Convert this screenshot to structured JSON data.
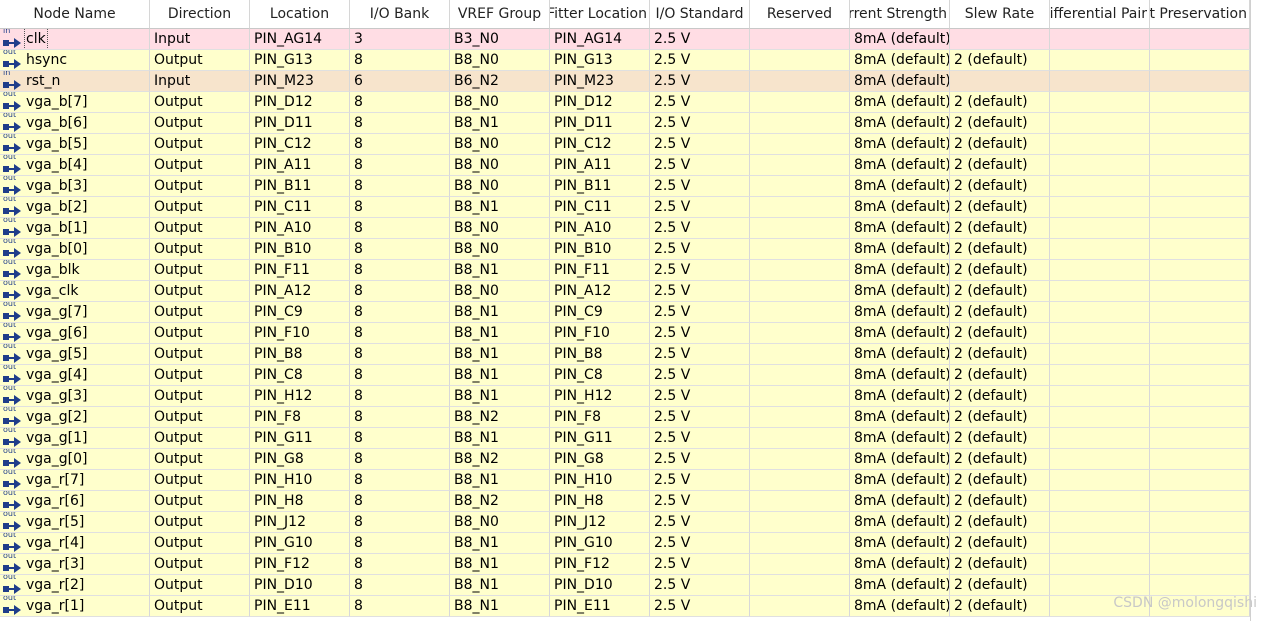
{
  "columns": [
    "Node Name",
    "Direction",
    "Location",
    "I/O Bank",
    "VREF Group",
    "Fitter Location",
    "I/O Standard",
    "Reserved",
    "Current Strength",
    "Slew Rate",
    "Differential Pair",
    "Strict Preservation"
  ],
  "rows": [
    {
      "name": "clk",
      "dir": "Input",
      "loc": "PIN_AG14",
      "bank": "3",
      "vref": "B3_N0",
      "fitter": "PIN_AG14",
      "std": "2.5 V",
      "reserved": "",
      "current": "8mA (default)",
      "slew": "",
      "diff": "",
      "strict": "",
      "icon": "in",
      "state": "sel"
    },
    {
      "name": "hsync",
      "dir": "Output",
      "loc": "PIN_G13",
      "bank": "8",
      "vref": "B8_N0",
      "fitter": "PIN_G13",
      "std": "2.5 V",
      "reserved": "",
      "current": "8mA (default)",
      "slew": "2 (default)",
      "diff": "",
      "strict": "",
      "icon": "out",
      "state": ""
    },
    {
      "name": "rst_n",
      "dir": "Input",
      "loc": "PIN_M23",
      "bank": "6",
      "vref": "B6_N2",
      "fitter": "PIN_M23",
      "std": "2.5 V",
      "reserved": "",
      "current": "8mA (default)",
      "slew": "",
      "diff": "",
      "strict": "",
      "icon": "in",
      "state": "hl"
    },
    {
      "name": "vga_b[7]",
      "dir": "Output",
      "loc": "PIN_D12",
      "bank": "8",
      "vref": "B8_N0",
      "fitter": "PIN_D12",
      "std": "2.5 V",
      "reserved": "",
      "current": "8mA (default)",
      "slew": "2 (default)",
      "diff": "",
      "strict": "",
      "icon": "out",
      "state": ""
    },
    {
      "name": "vga_b[6]",
      "dir": "Output",
      "loc": "PIN_D11",
      "bank": "8",
      "vref": "B8_N1",
      "fitter": "PIN_D11",
      "std": "2.5 V",
      "reserved": "",
      "current": "8mA (default)",
      "slew": "2 (default)",
      "diff": "",
      "strict": "",
      "icon": "out",
      "state": ""
    },
    {
      "name": "vga_b[5]",
      "dir": "Output",
      "loc": "PIN_C12",
      "bank": "8",
      "vref": "B8_N0",
      "fitter": "PIN_C12",
      "std": "2.5 V",
      "reserved": "",
      "current": "8mA (default)",
      "slew": "2 (default)",
      "diff": "",
      "strict": "",
      "icon": "out",
      "state": ""
    },
    {
      "name": "vga_b[4]",
      "dir": "Output",
      "loc": "PIN_A11",
      "bank": "8",
      "vref": "B8_N0",
      "fitter": "PIN_A11",
      "std": "2.5 V",
      "reserved": "",
      "current": "8mA (default)",
      "slew": "2 (default)",
      "diff": "",
      "strict": "",
      "icon": "out",
      "state": ""
    },
    {
      "name": "vga_b[3]",
      "dir": "Output",
      "loc": "PIN_B11",
      "bank": "8",
      "vref": "B8_N0",
      "fitter": "PIN_B11",
      "std": "2.5 V",
      "reserved": "",
      "current": "8mA (default)",
      "slew": "2 (default)",
      "diff": "",
      "strict": "",
      "icon": "out",
      "state": ""
    },
    {
      "name": "vga_b[2]",
      "dir": "Output",
      "loc": "PIN_C11",
      "bank": "8",
      "vref": "B8_N1",
      "fitter": "PIN_C11",
      "std": "2.5 V",
      "reserved": "",
      "current": "8mA (default)",
      "slew": "2 (default)",
      "diff": "",
      "strict": "",
      "icon": "out",
      "state": ""
    },
    {
      "name": "vga_b[1]",
      "dir": "Output",
      "loc": "PIN_A10",
      "bank": "8",
      "vref": "B8_N0",
      "fitter": "PIN_A10",
      "std": "2.5 V",
      "reserved": "",
      "current": "8mA (default)",
      "slew": "2 (default)",
      "diff": "",
      "strict": "",
      "icon": "out",
      "state": ""
    },
    {
      "name": "vga_b[0]",
      "dir": "Output",
      "loc": "PIN_B10",
      "bank": "8",
      "vref": "B8_N0",
      "fitter": "PIN_B10",
      "std": "2.5 V",
      "reserved": "",
      "current": "8mA (default)",
      "slew": "2 (default)",
      "diff": "",
      "strict": "",
      "icon": "out",
      "state": ""
    },
    {
      "name": "vga_blk",
      "dir": "Output",
      "loc": "PIN_F11",
      "bank": "8",
      "vref": "B8_N1",
      "fitter": "PIN_F11",
      "std": "2.5 V",
      "reserved": "",
      "current": "8mA (default)",
      "slew": "2 (default)",
      "diff": "",
      "strict": "",
      "icon": "out",
      "state": ""
    },
    {
      "name": "vga_clk",
      "dir": "Output",
      "loc": "PIN_A12",
      "bank": "8",
      "vref": "B8_N0",
      "fitter": "PIN_A12",
      "std": "2.5 V",
      "reserved": "",
      "current": "8mA (default)",
      "slew": "2 (default)",
      "diff": "",
      "strict": "",
      "icon": "out",
      "state": ""
    },
    {
      "name": "vga_g[7]",
      "dir": "Output",
      "loc": "PIN_C9",
      "bank": "8",
      "vref": "B8_N1",
      "fitter": "PIN_C9",
      "std": "2.5 V",
      "reserved": "",
      "current": "8mA (default)",
      "slew": "2 (default)",
      "diff": "",
      "strict": "",
      "icon": "out",
      "state": ""
    },
    {
      "name": "vga_g[6]",
      "dir": "Output",
      "loc": "PIN_F10",
      "bank": "8",
      "vref": "B8_N1",
      "fitter": "PIN_F10",
      "std": "2.5 V",
      "reserved": "",
      "current": "8mA (default)",
      "slew": "2 (default)",
      "diff": "",
      "strict": "",
      "icon": "out",
      "state": ""
    },
    {
      "name": "vga_g[5]",
      "dir": "Output",
      "loc": "PIN_B8",
      "bank": "8",
      "vref": "B8_N1",
      "fitter": "PIN_B8",
      "std": "2.5 V",
      "reserved": "",
      "current": "8mA (default)",
      "slew": "2 (default)",
      "diff": "",
      "strict": "",
      "icon": "out",
      "state": ""
    },
    {
      "name": "vga_g[4]",
      "dir": "Output",
      "loc": "PIN_C8",
      "bank": "8",
      "vref": "B8_N1",
      "fitter": "PIN_C8",
      "std": "2.5 V",
      "reserved": "",
      "current": "8mA (default)",
      "slew": "2 (default)",
      "diff": "",
      "strict": "",
      "icon": "out",
      "state": ""
    },
    {
      "name": "vga_g[3]",
      "dir": "Output",
      "loc": "PIN_H12",
      "bank": "8",
      "vref": "B8_N1",
      "fitter": "PIN_H12",
      "std": "2.5 V",
      "reserved": "",
      "current": "8mA (default)",
      "slew": "2 (default)",
      "diff": "",
      "strict": "",
      "icon": "out",
      "state": ""
    },
    {
      "name": "vga_g[2]",
      "dir": "Output",
      "loc": "PIN_F8",
      "bank": "8",
      "vref": "B8_N2",
      "fitter": "PIN_F8",
      "std": "2.5 V",
      "reserved": "",
      "current": "8mA (default)",
      "slew": "2 (default)",
      "diff": "",
      "strict": "",
      "icon": "out",
      "state": ""
    },
    {
      "name": "vga_g[1]",
      "dir": "Output",
      "loc": "PIN_G11",
      "bank": "8",
      "vref": "B8_N1",
      "fitter": "PIN_G11",
      "std": "2.5 V",
      "reserved": "",
      "current": "8mA (default)",
      "slew": "2 (default)",
      "diff": "",
      "strict": "",
      "icon": "out",
      "state": ""
    },
    {
      "name": "vga_g[0]",
      "dir": "Output",
      "loc": "PIN_G8",
      "bank": "8",
      "vref": "B8_N2",
      "fitter": "PIN_G8",
      "std": "2.5 V",
      "reserved": "",
      "current": "8mA (default)",
      "slew": "2 (default)",
      "diff": "",
      "strict": "",
      "icon": "out",
      "state": ""
    },
    {
      "name": "vga_r[7]",
      "dir": "Output",
      "loc": "PIN_H10",
      "bank": "8",
      "vref": "B8_N1",
      "fitter": "PIN_H10",
      "std": "2.5 V",
      "reserved": "",
      "current": "8mA (default)",
      "slew": "2 (default)",
      "diff": "",
      "strict": "",
      "icon": "out",
      "state": ""
    },
    {
      "name": "vga_r[6]",
      "dir": "Output",
      "loc": "PIN_H8",
      "bank": "8",
      "vref": "B8_N2",
      "fitter": "PIN_H8",
      "std": "2.5 V",
      "reserved": "",
      "current": "8mA (default)",
      "slew": "2 (default)",
      "diff": "",
      "strict": "",
      "icon": "out",
      "state": ""
    },
    {
      "name": "vga_r[5]",
      "dir": "Output",
      "loc": "PIN_J12",
      "bank": "8",
      "vref": "B8_N0",
      "fitter": "PIN_J12",
      "std": "2.5 V",
      "reserved": "",
      "current": "8mA (default)",
      "slew": "2 (default)",
      "diff": "",
      "strict": "",
      "icon": "out",
      "state": ""
    },
    {
      "name": "vga_r[4]",
      "dir": "Output",
      "loc": "PIN_G10",
      "bank": "8",
      "vref": "B8_N1",
      "fitter": "PIN_G10",
      "std": "2.5 V",
      "reserved": "",
      "current": "8mA (default)",
      "slew": "2 (default)",
      "diff": "",
      "strict": "",
      "icon": "out",
      "state": ""
    },
    {
      "name": "vga_r[3]",
      "dir": "Output",
      "loc": "PIN_F12",
      "bank": "8",
      "vref": "B8_N1",
      "fitter": "PIN_F12",
      "std": "2.5 V",
      "reserved": "",
      "current": "8mA (default)",
      "slew": "2 (default)",
      "diff": "",
      "strict": "",
      "icon": "out",
      "state": ""
    },
    {
      "name": "vga_r[2]",
      "dir": "Output",
      "loc": "PIN_D10",
      "bank": "8",
      "vref": "B8_N1",
      "fitter": "PIN_D10",
      "std": "2.5 V",
      "reserved": "",
      "current": "8mA (default)",
      "slew": "2 (default)",
      "diff": "",
      "strict": "",
      "icon": "out",
      "state": ""
    },
    {
      "name": "vga_r[1]",
      "dir": "Output",
      "loc": "PIN_E11",
      "bank": "8",
      "vref": "B8_N1",
      "fitter": "PIN_E11",
      "std": "2.5 V",
      "reserved": "",
      "current": "8mA (default)",
      "slew": "2 (default)",
      "diff": "",
      "strict": "",
      "icon": "out",
      "state": ""
    }
  ],
  "icon_labels": {
    "in": "in",
    "out": "out"
  },
  "colors": {
    "row_bg": "#ffffcc",
    "selected_row": "#ffdde4",
    "highlight_row": "#f7e4cc",
    "icon": "#1f3d8a"
  },
  "watermark": "CSDN @molongqishi"
}
